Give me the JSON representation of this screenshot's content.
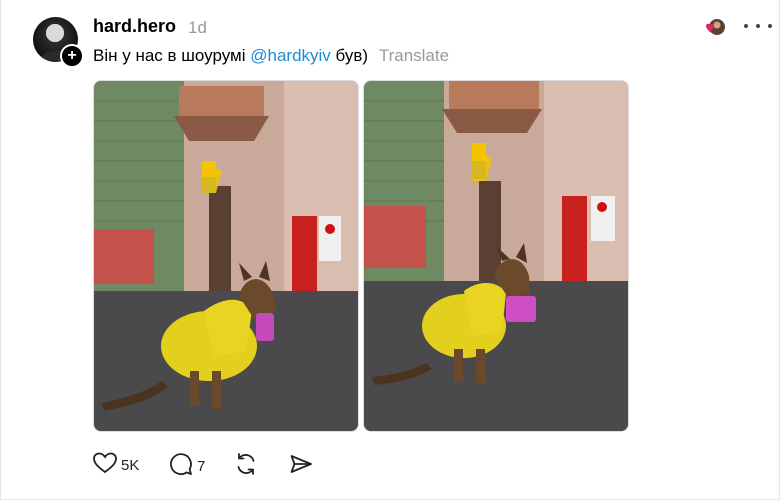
{
  "post": {
    "username": "hard.hero",
    "time": "1d",
    "caption_text_before": "Він у нас в шоурумі ",
    "mention": "@hardkyiv",
    "caption_text_after": " був)",
    "translate_label": "Translate"
  },
  "photos": [
    {
      "icon": "photo-dog-yellow-raincoat"
    },
    {
      "icon": "photo-dog-yellow-raincoat"
    }
  ],
  "actions": {
    "likes": "5K",
    "replies": "7",
    "icons": [
      "heart-icon",
      "comment-icon",
      "repost-icon",
      "share-icon"
    ]
  },
  "colors": {
    "accent": "#1a8cd8",
    "muted": "#999999",
    "reaction_red": "#e0245e"
  }
}
